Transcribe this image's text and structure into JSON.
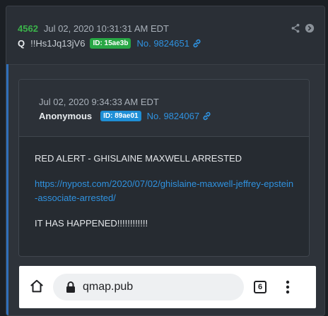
{
  "post": {
    "number": "4562",
    "date": "Jul 02, 2020 10:31:31 AM EDT",
    "author": "Q",
    "tripcode": "!!Hs1Jq13jV6",
    "id_badge": "ID: 15ae3b",
    "post_ref": "No. 9824651"
  },
  "quoted": {
    "date": "Jul 02, 2020 9:34:33 AM EDT",
    "author": "Anonymous",
    "id_badge": "ID: 89ae01",
    "post_ref": "No. 9824067",
    "line1": "RED ALERT - GHISLAINE MAXWELL ARRESTED",
    "url": "https://nypost.com/2020/07/02/ghislaine-maxwell-jeffrey-epstein-associate-arrested/",
    "line3": "IT HAS HAPPENED!!!!!!!!!!!!"
  },
  "browser": {
    "url": "qmap.pub",
    "tab_count": "6"
  },
  "colors": {
    "accent_green": "#28a745",
    "accent_blue": "#1f8fd6",
    "link_blue": "#2f92e0",
    "post_number": "#3bb34a"
  },
  "icons": [
    "share-icon",
    "arrow-circle-right-icon",
    "link-icon",
    "home-icon",
    "lock-icon",
    "more-vertical-icon"
  ]
}
